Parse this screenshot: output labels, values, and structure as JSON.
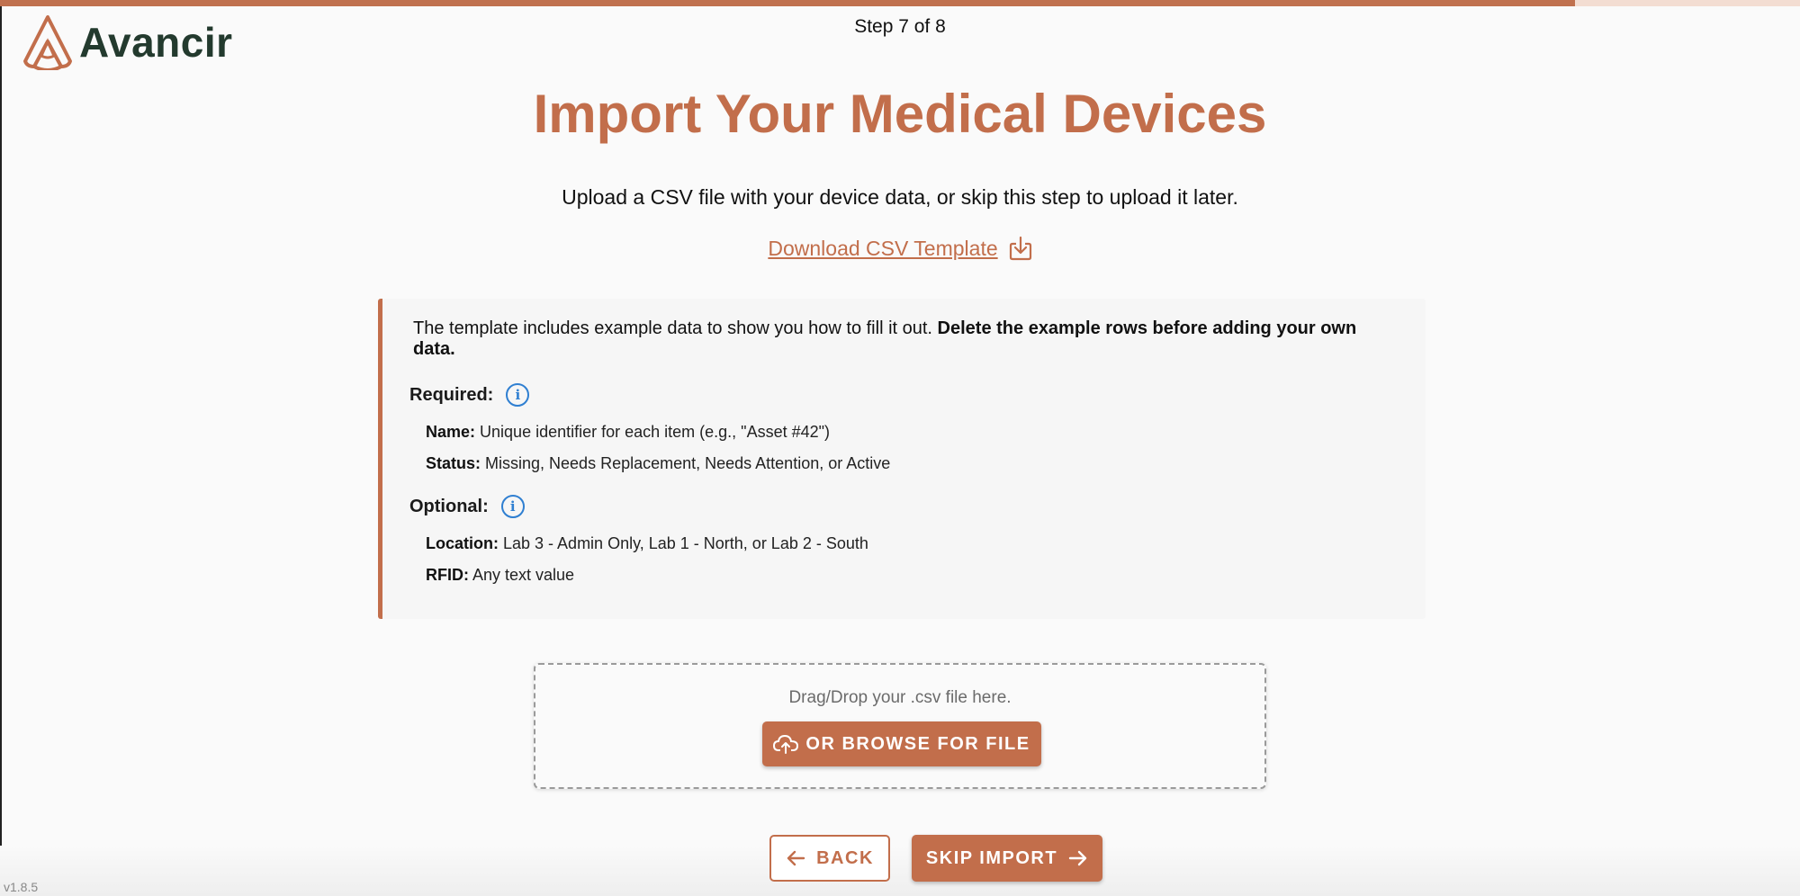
{
  "colors": {
    "accent": "#c26e4b",
    "brand_text": "#233a2e",
    "info_icon": "#2f7fd1"
  },
  "header": {
    "logo_text": "Avancir",
    "step_text": "Step 7 of 8",
    "progress_fraction": 0.875
  },
  "main": {
    "title": "Import Your Medical Devices",
    "subtitle": "Upload a CSV file with your device data, or skip this step to upload it later.",
    "download_link": "Download CSV Template",
    "download_icon": "download-icon"
  },
  "info": {
    "intro_plain": "The template includes example data to show you how to fill it out. ",
    "intro_bold": "Delete the example rows before adding your own data.",
    "required_label": "Required:",
    "required_fields": [
      {
        "label": "Name:",
        "value": " Unique identifier for each item (e.g., \"Asset #42\")"
      },
      {
        "label": "Status:",
        "value": " Missing, Needs Replacement, Needs Attention, or Active"
      }
    ],
    "optional_label": "Optional:",
    "optional_fields": [
      {
        "label": "Location:",
        "value": " Lab 3 - Admin Only, Lab 1 - North, or Lab 2 - South"
      },
      {
        "label": "RFID:",
        "value": " Any text value"
      }
    ],
    "info_icon_glyph": "i"
  },
  "upload": {
    "drop_text": "Drag/Drop your .csv file here.",
    "browse_label": "OR BROWSE FOR FILE",
    "browse_icon": "cloud-upload-icon"
  },
  "nav": {
    "back_label": "BACK",
    "skip_label": "SKIP IMPORT"
  },
  "footer": {
    "version": "v1.8.5"
  }
}
